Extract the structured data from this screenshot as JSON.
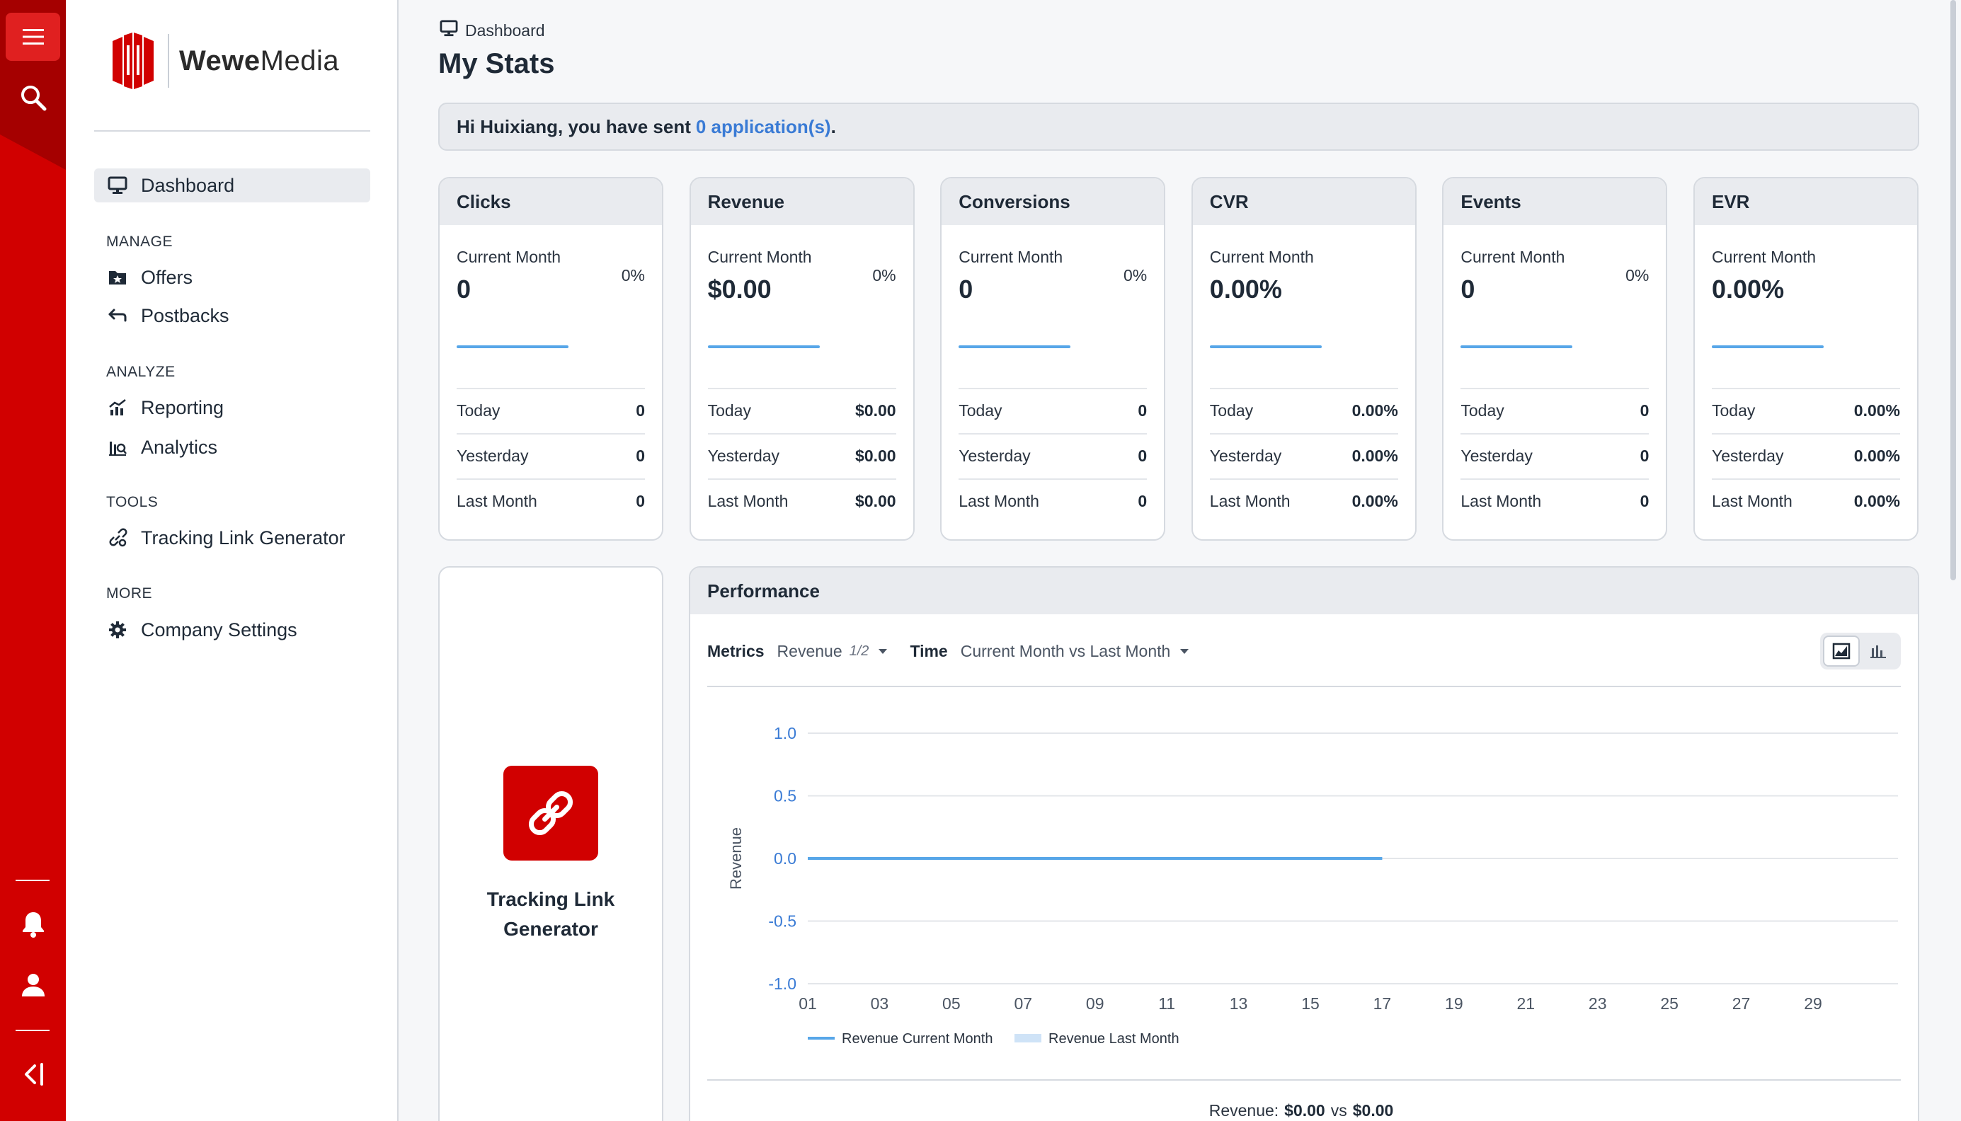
{
  "brand": {
    "name_bold": "Wewe",
    "name_light": "Media",
    "accent": "#d10000"
  },
  "rail": {
    "icons": [
      "menu-icon",
      "search-icon",
      "bell-icon",
      "user-icon",
      "collapse-sidebar-icon"
    ]
  },
  "sidebar": {
    "dashboard": "Dashboard",
    "sections": {
      "manage": "MANAGE",
      "analyze": "ANALYZE",
      "tools": "TOOLS",
      "more": "MORE"
    },
    "items": {
      "offers": "Offers",
      "postbacks": "Postbacks",
      "reporting": "Reporting",
      "analytics": "Analytics",
      "tracking_link_generator": "Tracking Link Generator",
      "company_settings": "Company Settings"
    }
  },
  "header": {
    "breadcrumb": "Dashboard",
    "title": "My Stats"
  },
  "alert": {
    "prefix": "Hi Huixiang, you have sent",
    "link": "0 application(s)",
    "suffix": "."
  },
  "stats": [
    {
      "title": "Clicks",
      "current_label": "Current Month",
      "current": "0",
      "change": "0%",
      "today": "0",
      "yesterday": "0",
      "last_month": "0"
    },
    {
      "title": "Revenue",
      "current_label": "Current Month",
      "current": "$0.00",
      "change": "0%",
      "today": "$0.00",
      "yesterday": "$0.00",
      "last_month": "$0.00"
    },
    {
      "title": "Conversions",
      "current_label": "Current Month",
      "current": "0",
      "change": "0%",
      "today": "0",
      "yesterday": "0",
      "last_month": "0"
    },
    {
      "title": "CVR",
      "current_label": "Current Month",
      "current": "0.00%",
      "change": "",
      "today": "0.00%",
      "yesterday": "0.00%",
      "last_month": "0.00%"
    },
    {
      "title": "Events",
      "current_label": "Current Month",
      "current": "0",
      "change": "0%",
      "today": "0",
      "yesterday": "0",
      "last_month": "0"
    },
    {
      "title": "EVR",
      "current_label": "Current Month",
      "current": "0.00%",
      "change": "",
      "today": "0.00%",
      "yesterday": "0.00%",
      "last_month": "0.00%"
    }
  ],
  "row_labels": {
    "today": "Today",
    "yesterday": "Yesterday",
    "last_month": "Last Month"
  },
  "tlg_card": {
    "line1": "Tracking Link",
    "line2": "Generator"
  },
  "performance": {
    "title": "Performance",
    "metrics_label": "Metrics",
    "metrics_value": "Revenue",
    "metrics_count": "1/2",
    "time_label": "Time",
    "time_value": "Current Month vs Last Month",
    "footer_label": "Revenue:",
    "footer_current": "$0.00",
    "footer_vs": "vs",
    "footer_previous": "$0.00"
  },
  "chart_data": {
    "type": "line",
    "ylabel": "Revenue",
    "ylim": [
      -1.0,
      1.0
    ],
    "yticks": [
      "1.0",
      "0.5",
      "0.0",
      "-0.5",
      "-1.0"
    ],
    "xticks": [
      "01",
      "03",
      "05",
      "07",
      "09",
      "11",
      "13",
      "15",
      "17",
      "19",
      "21",
      "23",
      "25",
      "27",
      "29"
    ],
    "x": [
      "01",
      "02",
      "03",
      "04",
      "05",
      "06",
      "07",
      "08",
      "09",
      "10",
      "11",
      "12",
      "13",
      "14",
      "15",
      "16",
      "17"
    ],
    "series": [
      {
        "name": "Revenue Current Month",
        "color": "#57a6e8",
        "values": [
          0,
          0,
          0,
          0,
          0,
          0,
          0,
          0,
          0,
          0,
          0,
          0,
          0,
          0,
          0,
          0,
          0
        ]
      },
      {
        "name": "Revenue Last Month",
        "color": "#cfe3f7",
        "values": []
      }
    ],
    "grid": true,
    "legend": "bottom-left"
  }
}
